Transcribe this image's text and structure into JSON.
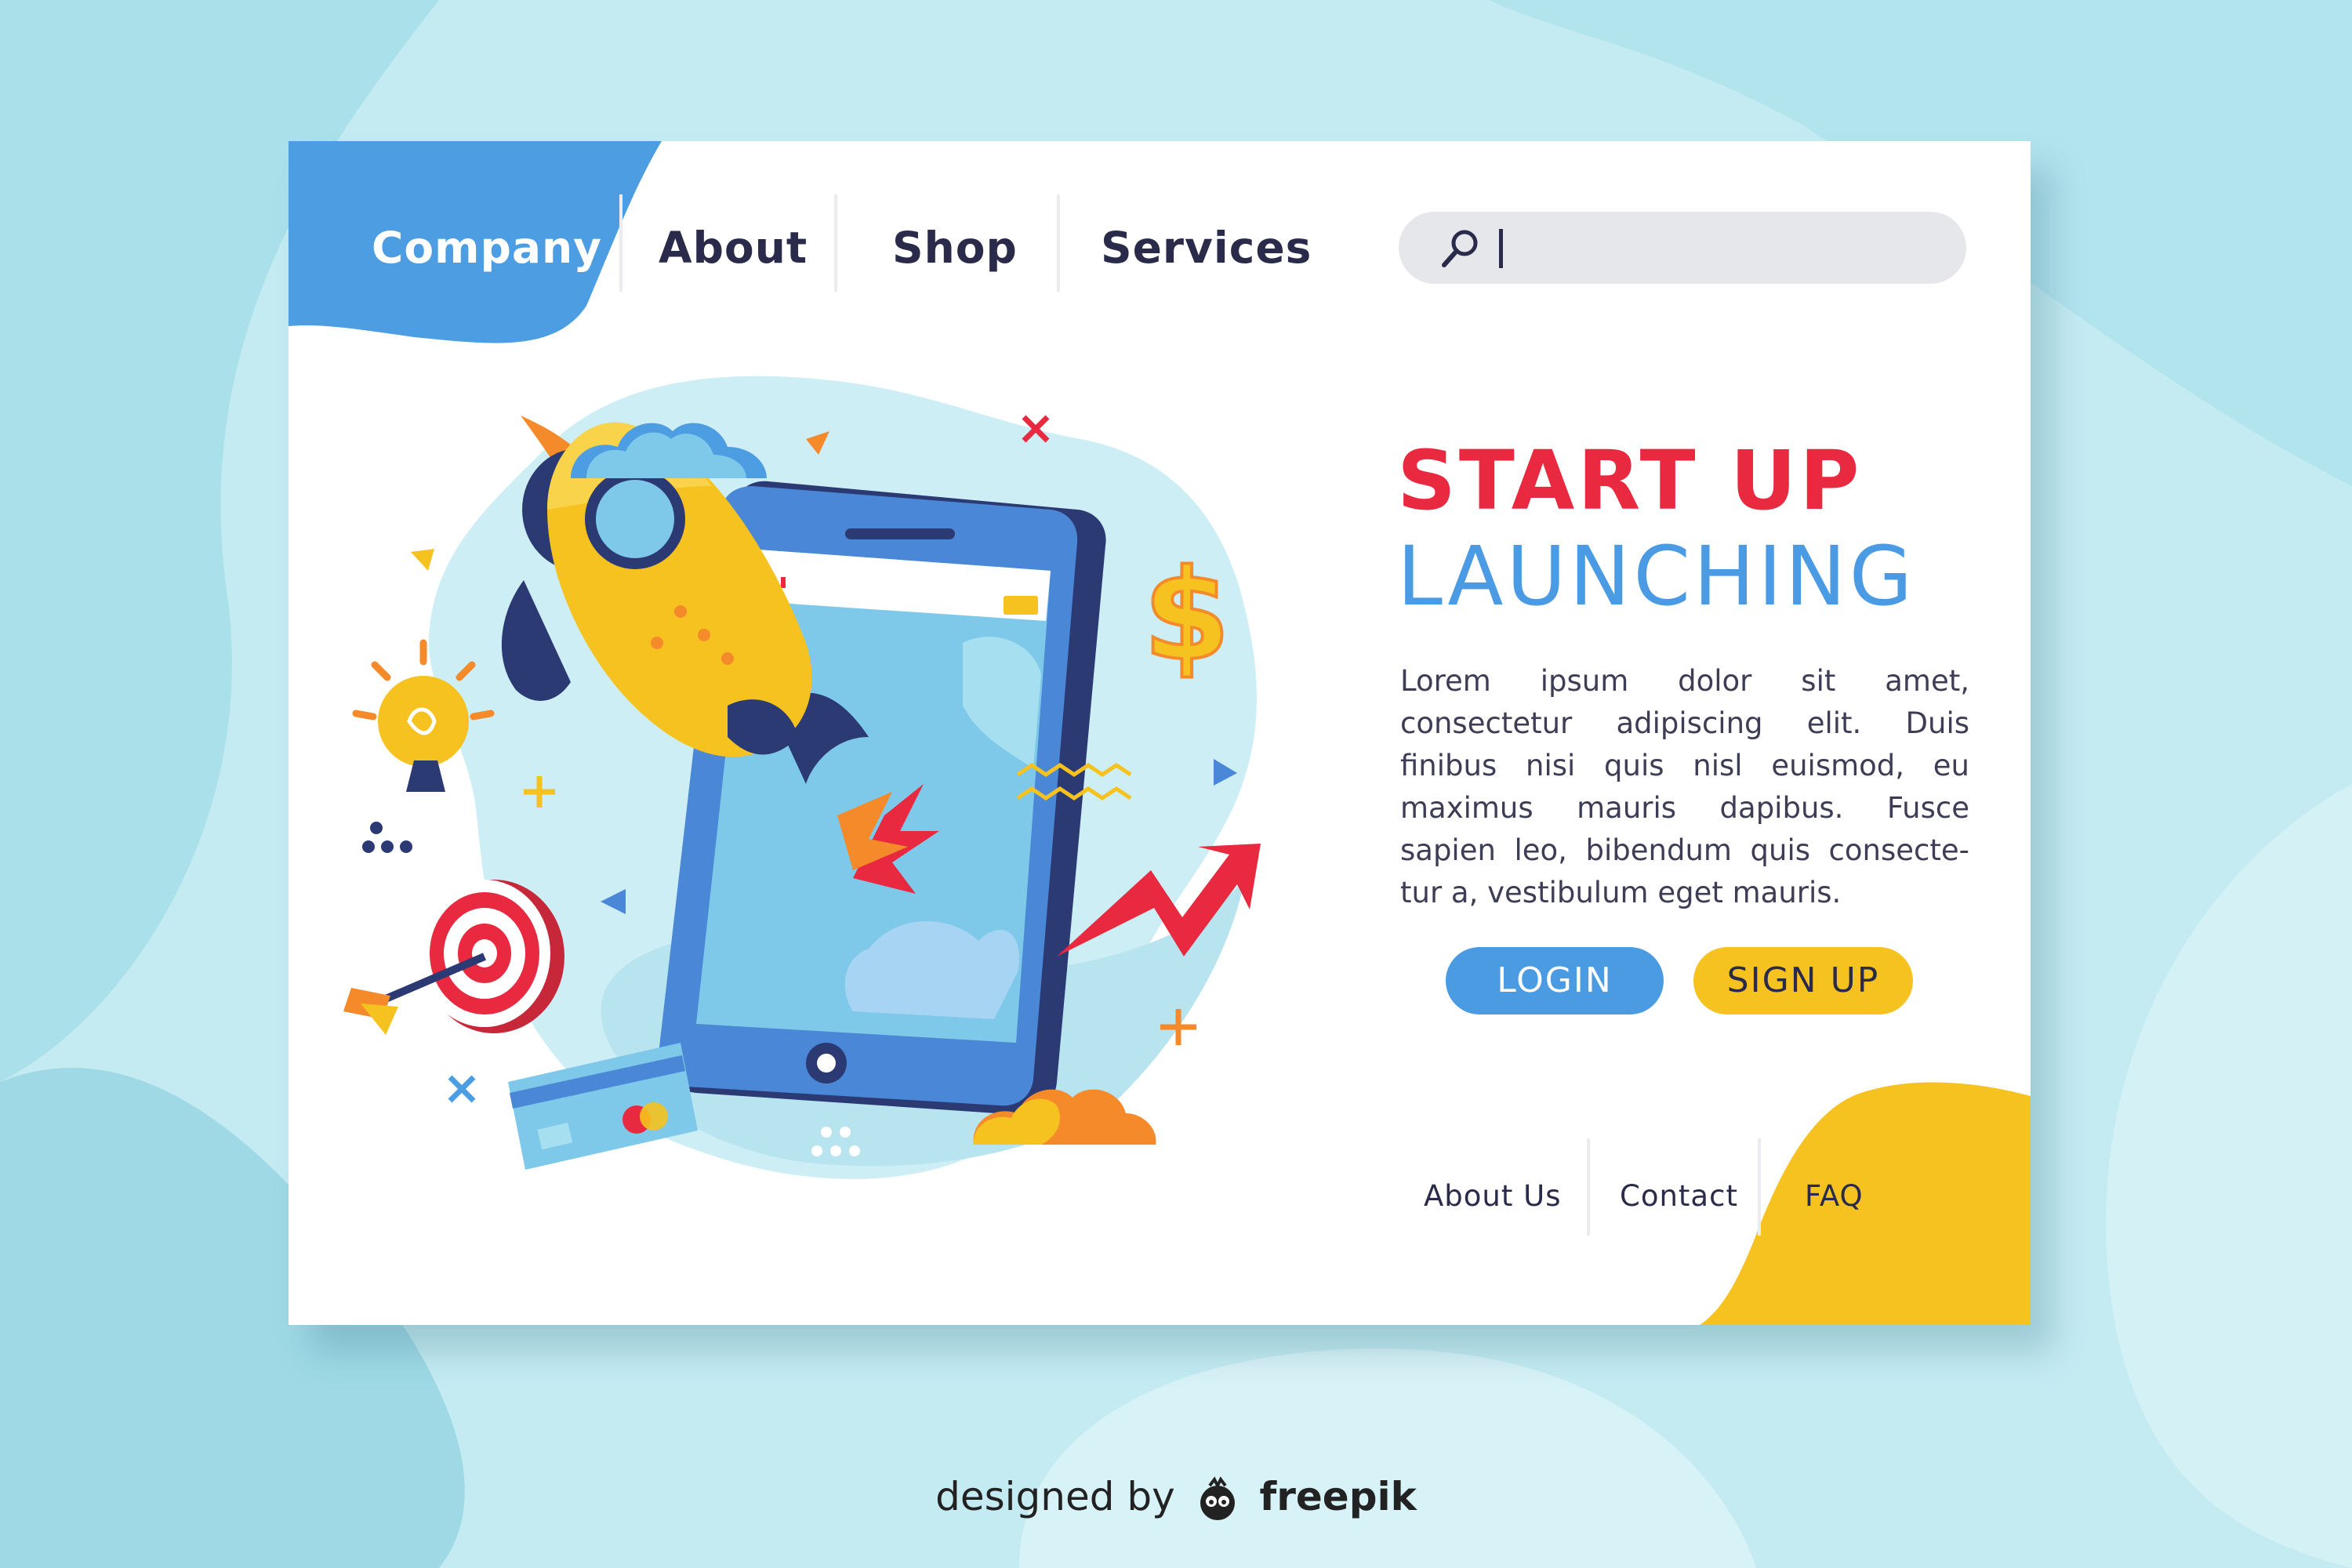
{
  "nav": {
    "items": [
      {
        "label": "Company"
      },
      {
        "label": "About"
      },
      {
        "label": "Shop"
      },
      {
        "label": "Services"
      }
    ]
  },
  "search": {
    "value": "",
    "placeholder": "",
    "icon": "search-icon"
  },
  "hero": {
    "title_line1": "START UP",
    "title_line2": "LAUNCHING",
    "body": "Lorem ipsum dolor sit amet, consectetur adipiscing elit. Duis finibus nisi quis nisl euismod, eu maximus mauris dapibus. Fusce sapien leo, bibendum quis consecte-tur a, vestibulum eget mauris."
  },
  "buttons": {
    "login": "LOGIN",
    "signup": "SIGN UP"
  },
  "footer": {
    "links": [
      "About Us",
      "Contact",
      "FAQ"
    ]
  },
  "credit": {
    "prefix": "designed by",
    "brand": "freepik"
  },
  "colors": {
    "accent_blue": "#4b9be3",
    "accent_red": "#e8293f",
    "accent_yellow": "#f6c21f",
    "text_dark": "#2a2a4a",
    "background": "#bfe9f0"
  },
  "icons": [
    "search-icon",
    "rocket-icon",
    "phone-icon",
    "lightbulb-icon",
    "target-icon",
    "dollar-icon",
    "credit-card-icon",
    "cloud-icon",
    "arrow-up-icon",
    "freepik-logo-icon"
  ]
}
